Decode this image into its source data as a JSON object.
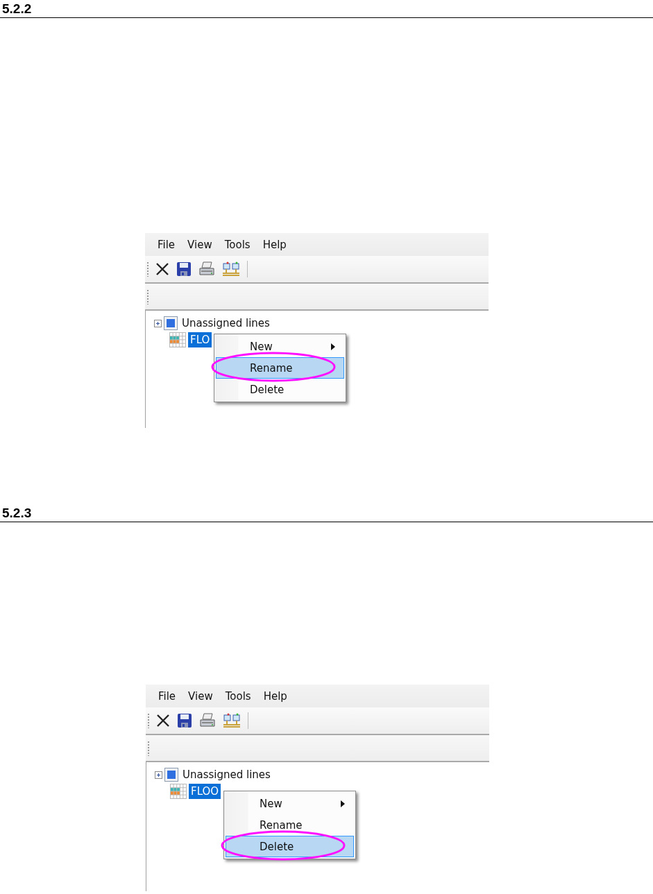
{
  "sections": [
    {
      "heading": "5.2.2",
      "window": {
        "menu_bar": [
          "File",
          "View",
          "Tools",
          "Help"
        ],
        "tree": [
          {
            "label": "Unassigned lines",
            "kind": "group",
            "expanded": false,
            "selected": false
          },
          {
            "label": "FLO",
            "kind": "floor",
            "selected": true
          }
        ],
        "context_menu": [
          {
            "label": "New",
            "submenu": true,
            "selected": false
          },
          {
            "label": "Rename",
            "submenu": false,
            "selected": true
          },
          {
            "label": "Delete",
            "submenu": false,
            "selected": false
          }
        ]
      }
    },
    {
      "heading": "5.2.3",
      "window": {
        "menu_bar": [
          "File",
          "View",
          "Tools",
          "Help"
        ],
        "tree": [
          {
            "label": "Unassigned lines",
            "kind": "group",
            "expanded": false,
            "selected": false
          },
          {
            "label": "FLOO",
            "kind": "floor",
            "selected": true
          }
        ],
        "context_menu": [
          {
            "label": "New",
            "submenu": true,
            "selected": false
          },
          {
            "label": "Rename",
            "submenu": false,
            "selected": false
          },
          {
            "label": "Delete",
            "submenu": false,
            "selected": true
          }
        ]
      }
    }
  ]
}
